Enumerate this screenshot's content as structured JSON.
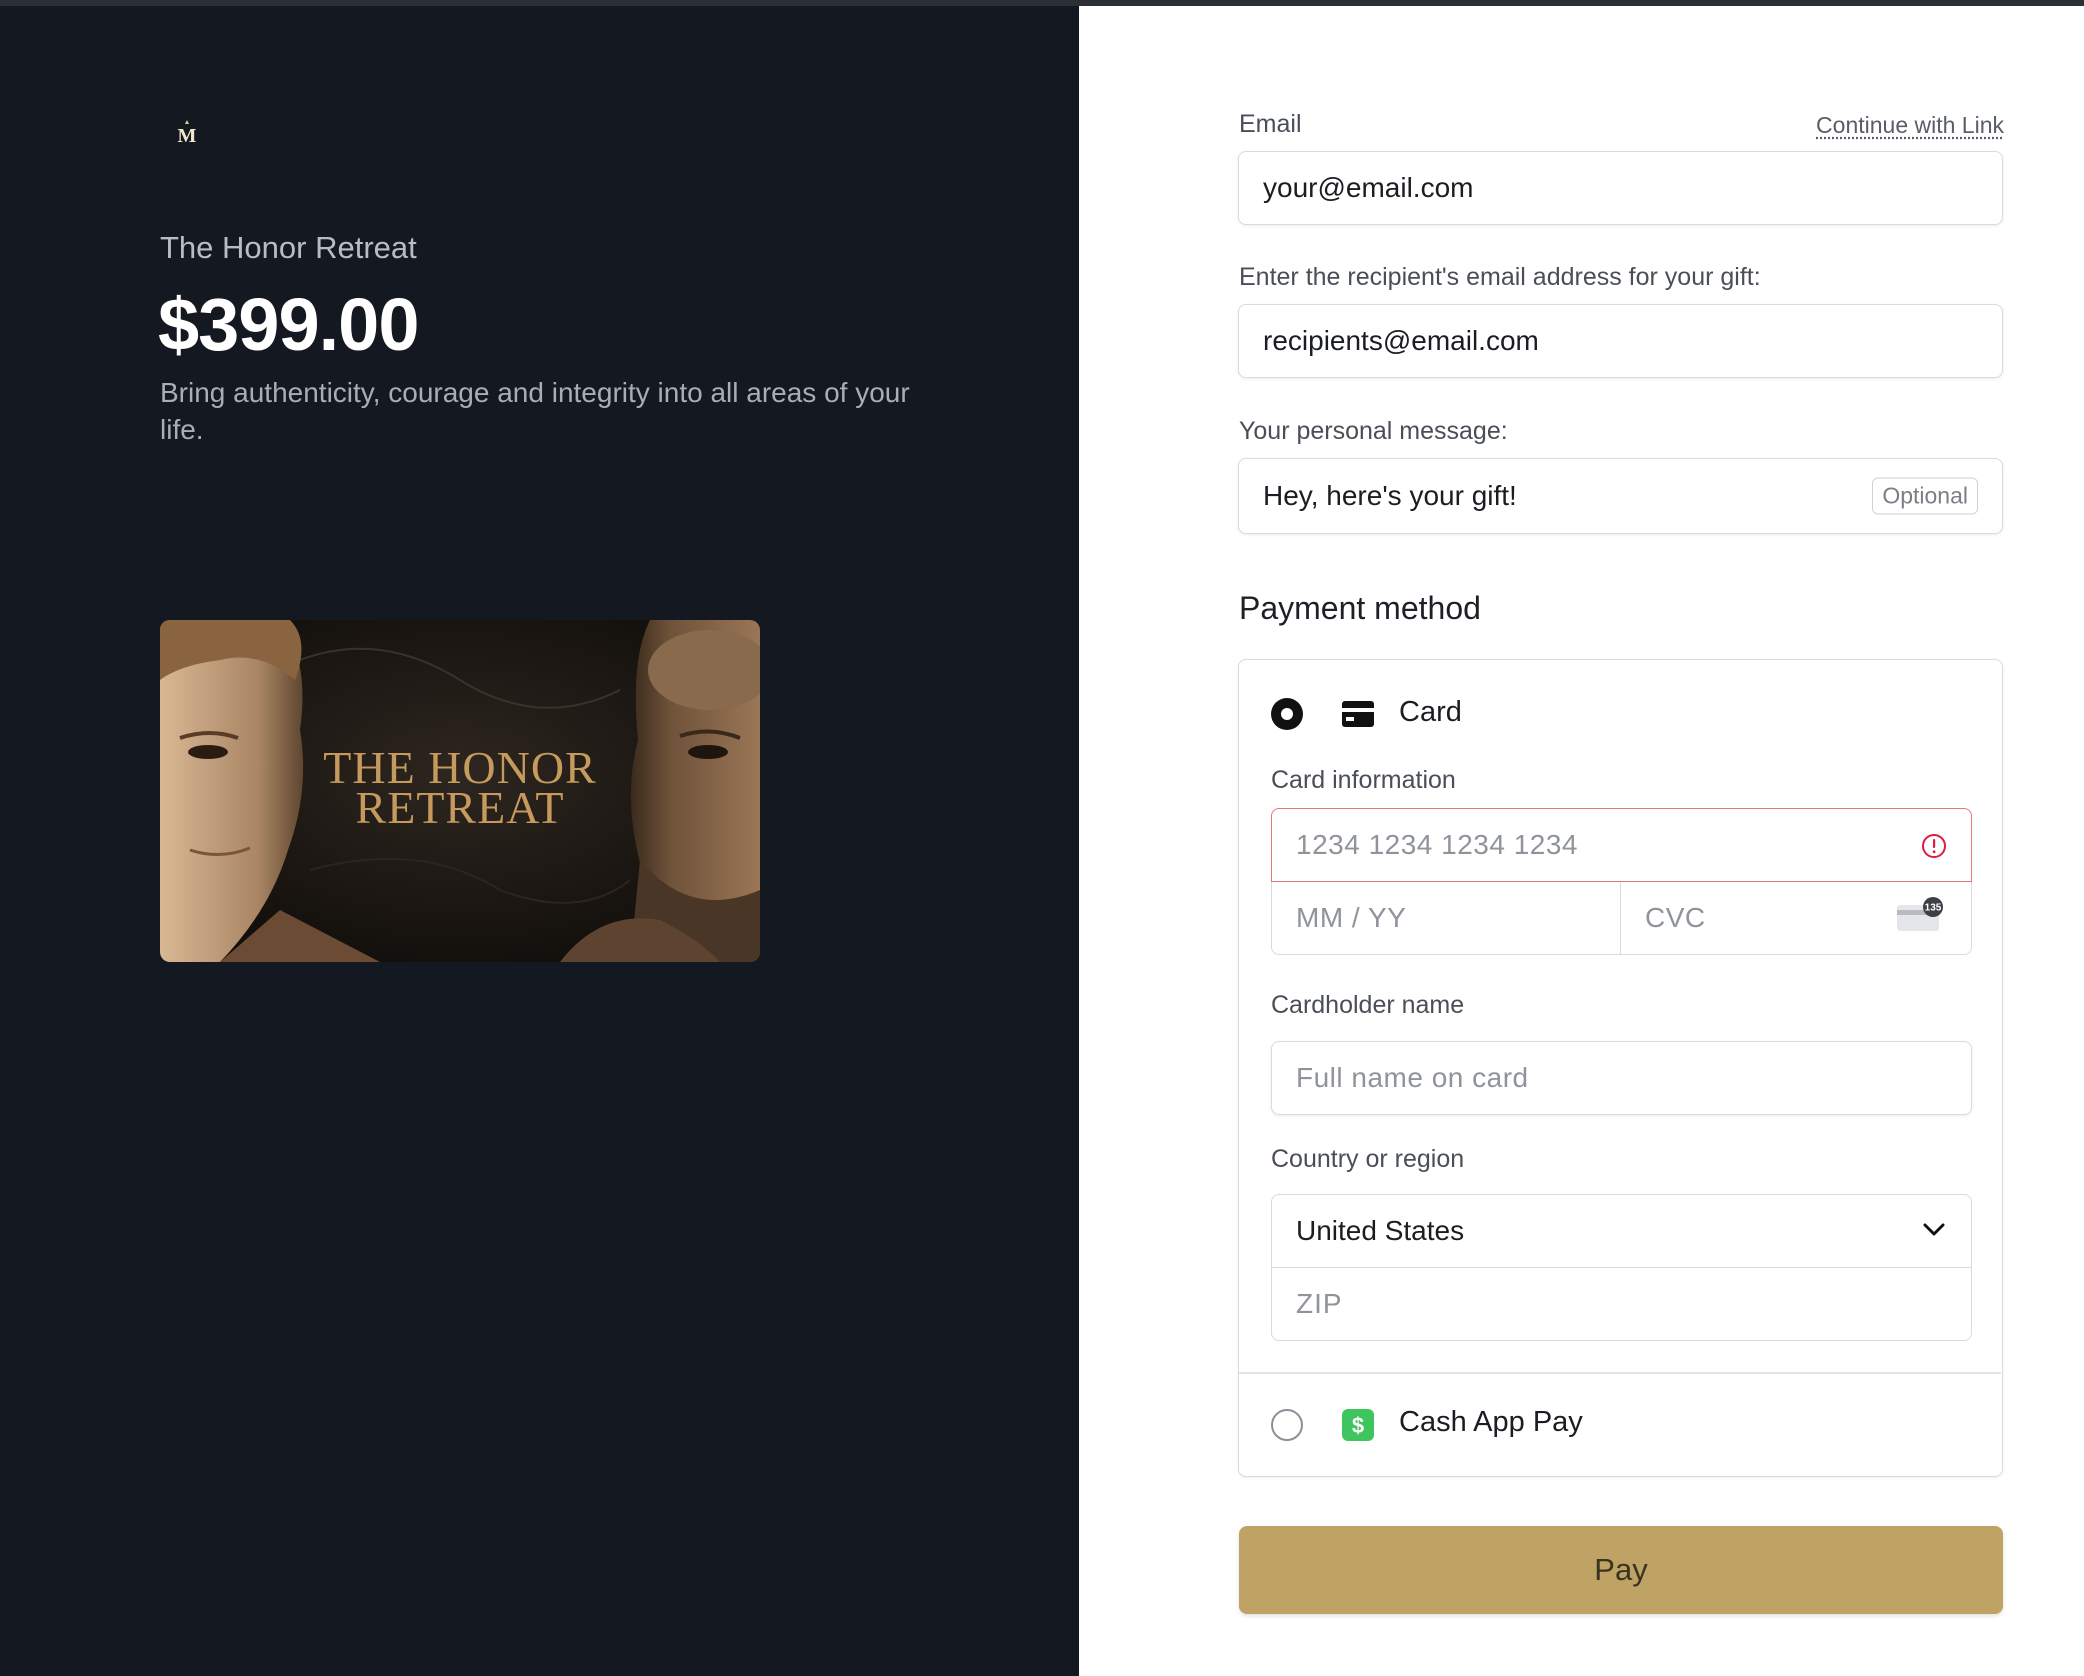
{
  "left": {
    "logo_letter": "M",
    "product_name": "The Honor Retreat",
    "price": "$399.00",
    "description": "Bring authenticity, courage and integrity into all areas of your life.",
    "banner": {
      "title_line1": "THE HONOR",
      "title_line2": "RETREAT"
    }
  },
  "form": {
    "email": {
      "label": "Email",
      "link": "Continue with Link",
      "value": "your@email.com"
    },
    "recipient": {
      "label": "Enter the recipient's email address for your gift:",
      "value": "recipients@email.com"
    },
    "message": {
      "label": "Your personal message:",
      "value": "Hey, here's your gift!",
      "badge": "Optional"
    }
  },
  "payment": {
    "title": "Payment method",
    "card_option": {
      "label": "Card",
      "selected": true,
      "icon": "credit-card-icon"
    },
    "card_info": {
      "label": "Card information",
      "number_placeholder": "1234 1234 1234 1234",
      "expiry_placeholder": "MM / YY",
      "cvc_placeholder": "CVC",
      "cvc_badge": "135",
      "error_icon": "alert-circle-icon"
    },
    "cardholder": {
      "label": "Cardholder name",
      "placeholder": "Full name on card"
    },
    "country": {
      "label": "Country or region",
      "selected": "United States",
      "zip_placeholder": "ZIP"
    },
    "cashapp_option": {
      "label": "Cash App Pay",
      "selected": false,
      "icon": "cash-app-icon"
    }
  },
  "pay_button": {
    "label": "Pay"
  },
  "colors": {
    "left_bg": "#141821",
    "accent": "#bfa365",
    "error": "#df1b41",
    "cashapp": "#3ec55d"
  }
}
